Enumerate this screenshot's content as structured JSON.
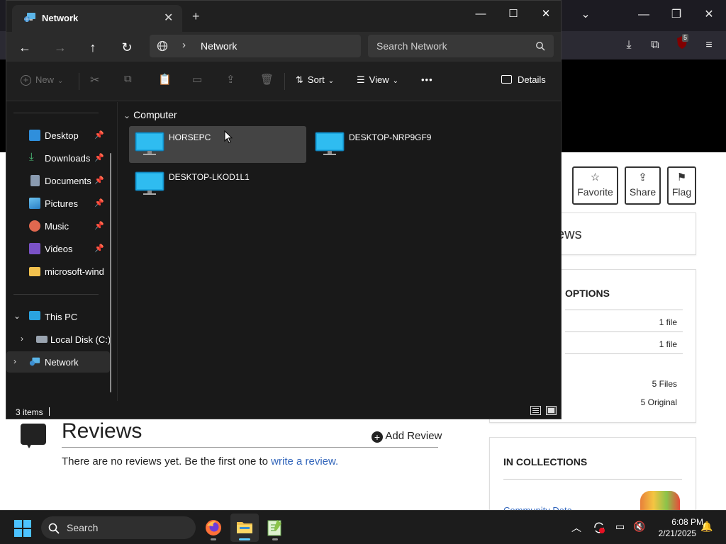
{
  "explorer": {
    "tab_title": "Network",
    "address_path": "Network",
    "search_placeholder": "Search Network",
    "commands": {
      "new": "New",
      "sort": "Sort",
      "view": "View",
      "more": "•••",
      "details": "Details"
    },
    "sidebar": {
      "quick_access": [
        {
          "label": "Desktop",
          "icon": "desktop-icon",
          "pinned": true
        },
        {
          "label": "Downloads",
          "icon": "download-icon",
          "pinned": true
        },
        {
          "label": "Documents",
          "icon": "document-icon",
          "pinned": true
        },
        {
          "label": "Pictures",
          "icon": "pictures-icon",
          "pinned": true
        },
        {
          "label": "Music",
          "icon": "music-icon",
          "pinned": true
        },
        {
          "label": "Videos",
          "icon": "videos-icon",
          "pinned": true
        },
        {
          "label": "microsoft-windows",
          "icon": "folder-icon",
          "pinned": false
        }
      ],
      "this_pc": "This PC",
      "local_disk": "Local Disk (C:)",
      "network": "Network"
    },
    "group_header": "Computer",
    "computers": [
      {
        "name": "HORSEPC",
        "selected": true
      },
      {
        "name": "DESKTOP-NRP9GF9",
        "selected": false
      },
      {
        "name": "DESKTOP-LKOD1L1",
        "selected": false
      }
    ],
    "status": "3 items"
  },
  "page": {
    "actions": {
      "favorite": "Favorite",
      "share": "Share",
      "flag": "Flag"
    },
    "reviews_fragment": "ews",
    "options_title": "OPTIONS",
    "option_rows": [
      "1 file",
      "1 file",
      "5 Files",
      "5 Original"
    ],
    "collections_title": "IN COLLECTIONS",
    "collection_link": "Community Data",
    "reviews_title": "Reviews",
    "add_review": "Add Review",
    "no_reviews_prefix": "There are no reviews yet. Be the first one to ",
    "write_review_link": "write a review."
  },
  "browser": {
    "badge_count": "5"
  },
  "taskbar": {
    "search": "Search",
    "time": "6:08 PM",
    "date": "2/21/2025"
  },
  "colors": {
    "accent": "#60cdff",
    "monitor": "#1aa7e0",
    "link": "#3366bb"
  }
}
